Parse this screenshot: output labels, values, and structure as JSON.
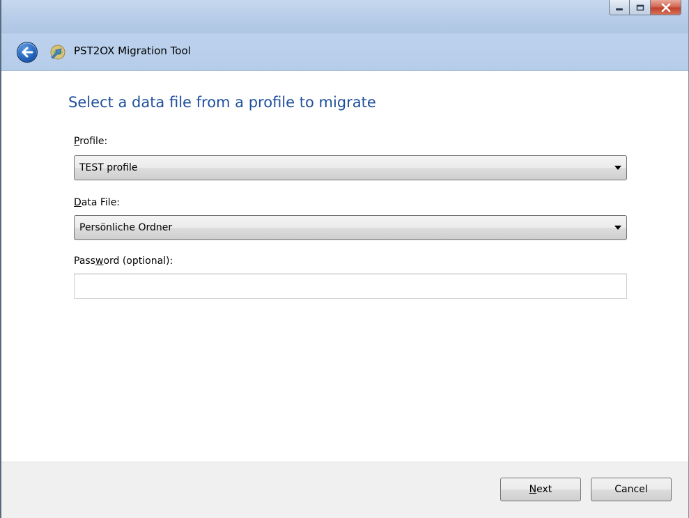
{
  "window": {
    "title": "PST2OX Migration Tool",
    "caption_buttons": [
      "minimize",
      "maximize",
      "close"
    ]
  },
  "wizard": {
    "heading": "Select a data file from a profile to migrate",
    "profile": {
      "label_accel": "P",
      "label_rest": "rofile:",
      "value": "TEST profile"
    },
    "data_file": {
      "label_accel": "D",
      "label_rest": "ata File:",
      "value": "Persönliche Ordner"
    },
    "password": {
      "label_pre": "Pass",
      "label_accel": "w",
      "label_rest": "ord (optional):",
      "value": ""
    }
  },
  "footer": {
    "next_accel": "N",
    "next_rest": "ext",
    "cancel_label": "Cancel"
  },
  "icons": {
    "back": "back-arrow-icon",
    "app": "app-icon"
  },
  "colors": {
    "heading": "#1e4f9c",
    "titlebar": "#b8cde8",
    "footer": "#f0f0f0"
  }
}
